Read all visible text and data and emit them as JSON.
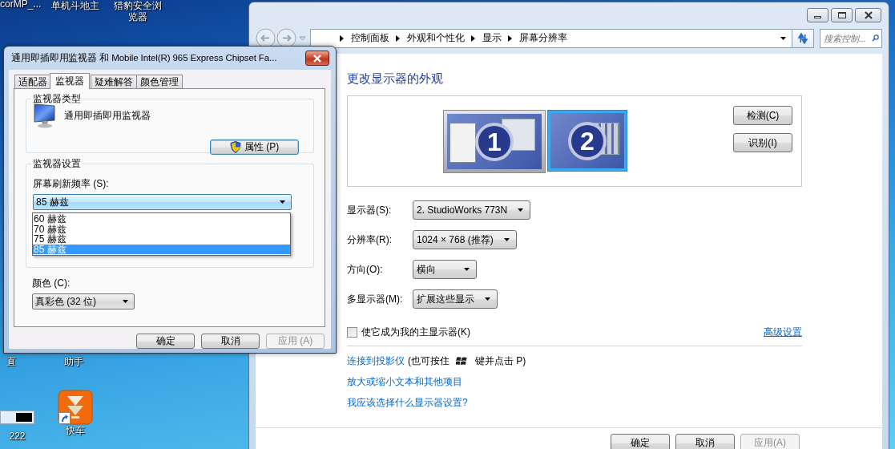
{
  "desktop": {
    "icons": [
      {
        "label": "corMP_...",
        "kind": "label"
      },
      {
        "label": "单机斗地主",
        "kind": "label"
      },
      {
        "label": "猎豹安全浏览器",
        "kind": "label"
      },
      {
        "label": "直",
        "kind": "label"
      },
      {
        "label": "助手",
        "kind": "label"
      },
      {
        "label": "222",
        "kind": "screenshot"
      },
      {
        "label": "快车",
        "kind": "app"
      }
    ]
  },
  "control_panel": {
    "breadcrumb": [
      "控制面板",
      "外观和个性化",
      "显示",
      "屏幕分辨率"
    ],
    "search": {
      "placeholder": "搜索控制..."
    },
    "heading": "更改显示器的外观",
    "monitors": [
      {
        "label": "1",
        "selected": false
      },
      {
        "label": "2",
        "selected": true
      }
    ],
    "side_buttons": [
      {
        "label": "检测(C)"
      },
      {
        "label": "识别(I)"
      }
    ],
    "settings": [
      {
        "label": "显示器(S):",
        "value": "2. StudioWorks 773N"
      },
      {
        "label": "分辨率(R):",
        "value": "1024 × 768 (推荐)"
      },
      {
        "label": "方向(O):",
        "value": "横向"
      },
      {
        "label": "多显示器(M):",
        "value": "扩展这些显示"
      }
    ],
    "primary_checkbox": {
      "label": "使它成为我的主显示器(K)",
      "checked": false
    },
    "advanced_link": "高级设置",
    "projector": {
      "link": "连接到投影仪",
      "before_key": "(也可按住",
      "after_key": "键并点击 P)"
    },
    "links": [
      "放大或缩小文本和其他项目",
      "我应该选择什么显示器设置?"
    ],
    "buttons": [
      {
        "label": "确定",
        "disabled": false
      },
      {
        "label": "取消",
        "disabled": false
      },
      {
        "label": "应用(A)",
        "disabled": true
      }
    ]
  },
  "dialog": {
    "title": "通用即插即用监视器 和 Mobile Intel(R) 965 Express Chipset Fa...",
    "tabs": [
      {
        "label": "适配器",
        "selected": false
      },
      {
        "label": "监视器",
        "selected": true
      },
      {
        "label": "疑难解答",
        "selected": false
      },
      {
        "label": "颜色管理",
        "selected": false
      }
    ],
    "monitor_type": {
      "legend": "监视器类型",
      "name": "通用即插即用监视器",
      "button": "属性 (P)"
    },
    "monitor_settings": {
      "legend": "监视器设置",
      "refresh_label": "屏幕刷新频率 (S):",
      "refresh_value": "85 赫兹",
      "options": [
        {
          "label": "60 赫兹",
          "selected": false
        },
        {
          "label": "70 赫兹",
          "selected": false
        },
        {
          "label": "75 赫兹",
          "selected": false
        },
        {
          "label": "85 赫兹",
          "selected": true
        }
      ]
    },
    "color": {
      "label": "颜色 (C):",
      "value": "真彩色 (32 位)"
    },
    "buttons": [
      {
        "label": "确定",
        "disabled": false
      },
      {
        "label": "取消",
        "disabled": false
      },
      {
        "label": "应用 (A)",
        "disabled": true
      }
    ]
  }
}
